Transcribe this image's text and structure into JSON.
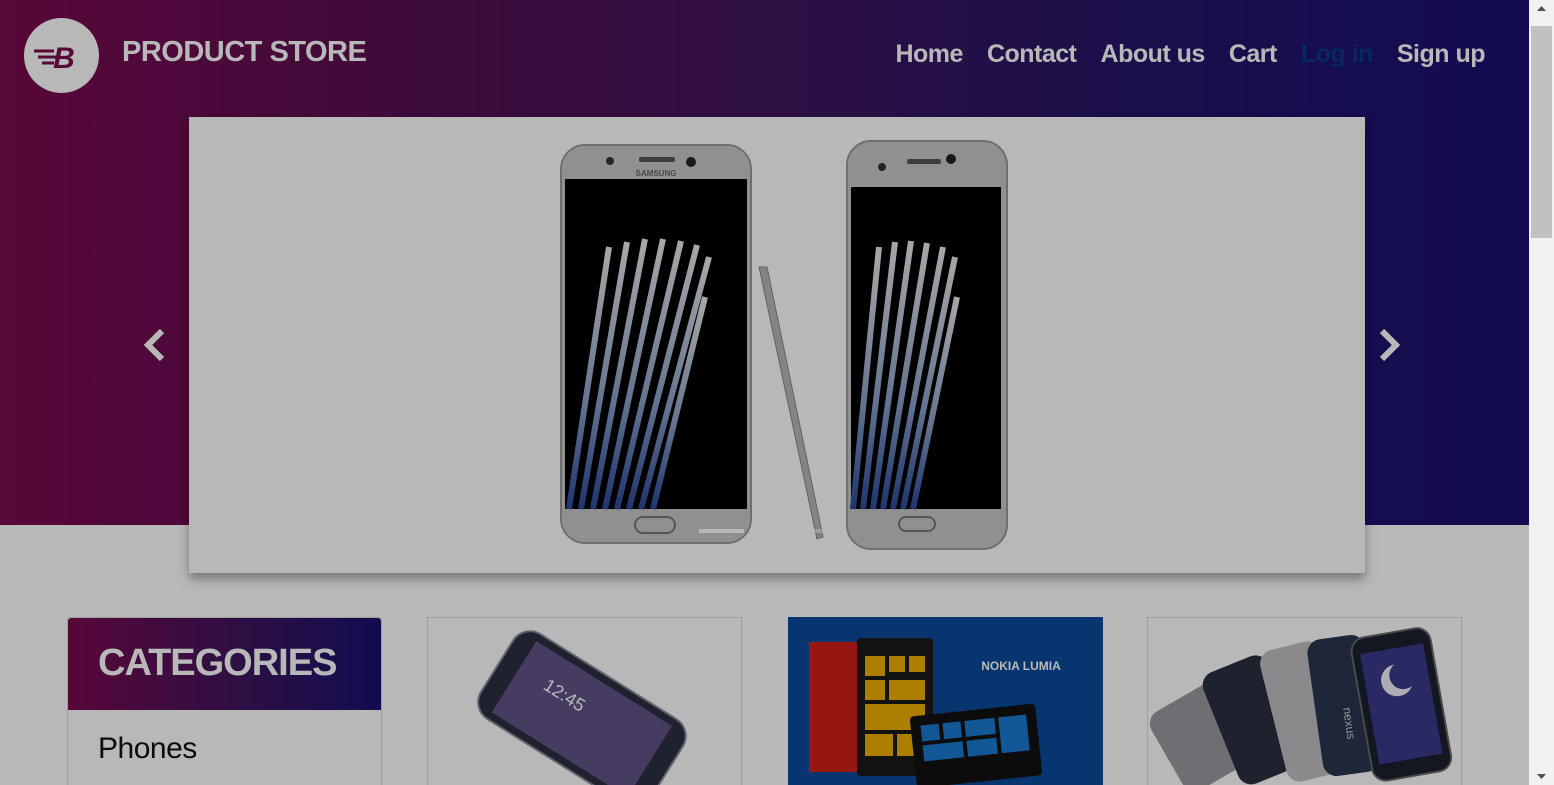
{
  "navbar": {
    "brand": "PRODUCT STORE",
    "logo_letter": "B",
    "links": [
      {
        "label": "Home"
      },
      {
        "label": "Contact"
      },
      {
        "label": "About us"
      },
      {
        "label": "Cart"
      },
      {
        "label": "Log in"
      },
      {
        "label": "Sign up"
      }
    ]
  },
  "carousel": {
    "image_subject": "Samsung Galaxy Note phones with stylus",
    "brand_mark": "SAMSUNG",
    "prev_icon": "chevron-left-icon",
    "next_icon": "chevron-right-icon",
    "slide_count": 3,
    "active_slide": 1
  },
  "categories": {
    "header": "CATEGORIES",
    "items": [
      {
        "label": "Phones"
      }
    ]
  },
  "products": [
    {
      "image_subject": "Samsung galaxy s6",
      "screen_time": "12:45"
    },
    {
      "image_subject": "Nokia lumia",
      "banner_text": "NOKIA LUMIA"
    },
    {
      "image_subject": "Nexus 6",
      "device_text": "nexus"
    }
  ],
  "colors": {
    "gradient_start": "#7a0a4e",
    "gradient_end": "#1a1070",
    "login_link": "#0a3a8a",
    "nokia_bg": "#0a4a9a"
  }
}
